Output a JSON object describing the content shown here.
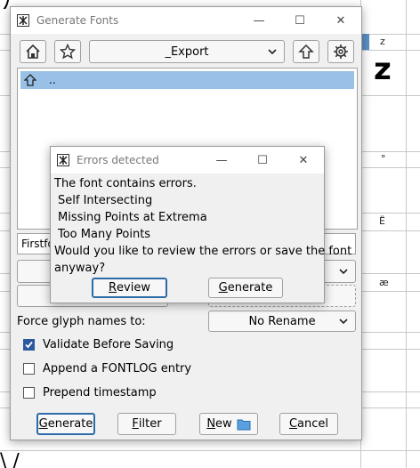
{
  "generate_dialog": {
    "title": "Generate Fonts",
    "directory": "_Export",
    "file_list": [
      {
        "name": ".."
      }
    ],
    "filename_value": "Firstfo",
    "force_glyph_names_label": "Force glyph names to:",
    "glyph_names_value": "No Rename",
    "options": [
      {
        "label": "Validate Before Saving",
        "checked": true
      },
      {
        "label": "Append a FONTLOG entry",
        "checked": false
      },
      {
        "label": "Prepend timestamp",
        "checked": false
      }
    ],
    "buttons": {
      "generate": {
        "pre": "",
        "u": "G",
        "post": "enerate"
      },
      "filter": {
        "pre": "",
        "u": "F",
        "post": "ilter"
      },
      "new": {
        "pre": "",
        "u": "N",
        "post": "ew"
      },
      "cancel": {
        "pre": "",
        "u": "C",
        "post": "ancel"
      }
    }
  },
  "errors_dialog": {
    "title": "Errors detected",
    "message": "The font contains errors.",
    "errors": [
      "Self Intersecting",
      "Missing Points at Extrema",
      "Too Many Points"
    ],
    "question_line1": "Would you like to review the errors or save the font",
    "question_line2": "anyway?",
    "buttons": {
      "review": {
        "pre": "",
        "u": "R",
        "post": "eview"
      },
      "generate": {
        "pre": "",
        "u": "G",
        "post": "enerate"
      }
    }
  },
  "background": {
    "glyph_labels": [
      "z",
      "z",
      "°",
      "Ë",
      "æ"
    ]
  },
  "colors": {
    "selection": "#99c1e8",
    "checkbox_checked": "#2c5aa0",
    "default_button_border": "#2d6ba8"
  }
}
